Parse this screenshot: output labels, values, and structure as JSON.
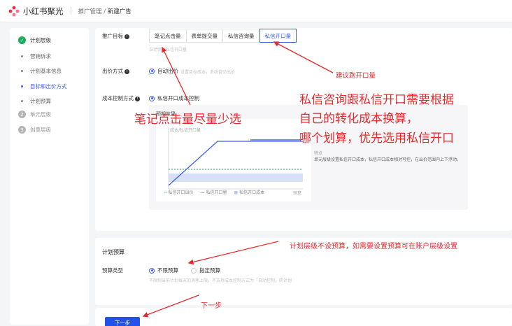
{
  "header": {
    "app_name": "小红书聚光",
    "breadcrumb_parent": "推广管理",
    "breadcrumb_sep": " / ",
    "breadcrumb_current": "新建广告"
  },
  "sidebar": {
    "steps": [
      {
        "num": "✓",
        "label": "计划层级",
        "state": "done"
      },
      {
        "num": "2",
        "label": "单元层级",
        "state": "pending"
      },
      {
        "num": "3",
        "label": "创意层级",
        "state": "pending"
      }
    ],
    "substeps": [
      {
        "label": "营销诉求"
      },
      {
        "label": "计划基本信息"
      },
      {
        "label": "目标和出价方式",
        "active": true
      },
      {
        "label": "计划预算"
      }
    ]
  },
  "form": {
    "goal_label": "推广目标",
    "goal_tabs": [
      "笔记点击量",
      "表单提交量",
      "私信咨询量",
      "私信开口量"
    ],
    "goal_selected": "私信开口量",
    "goal_hint": "自动优化私信开口量",
    "bid_label": "出价方式",
    "bid_option": "自动出价",
    "bid_hint": "设置目标成本，系统自动出价",
    "cost_label": "成本控制方式",
    "cost_option": "私信开口成本控制",
    "chart_title": "预期效果",
    "chart_ylabel": "成本/私信开口量",
    "chart_xlabel": "预算",
    "legend": [
      "私信开口出价",
      "私信开口量",
      "私信开口成本"
    ],
    "side_text_title": "特点",
    "side_text_body": "单元层级设置私信开口成本，私信开口成本相对可控，在出价范围内上下浮动。"
  },
  "budget": {
    "section_title": "计划预算",
    "type_label": "预算类型",
    "opt_unlimited": "不限预算",
    "opt_specified": "指定预算",
    "hint": "不限制当前计划每天的消耗上限，不支持成本控制方式为「自动控制」的计划"
  },
  "footer": {
    "next_label": "下一步"
  },
  "annotations": {
    "a1": "建议跑开口量",
    "a2_line1": "私信咨询跟私信开口需要根据",
    "a2_line2": "自己的转化成本换算，",
    "a2_line3": "哪个划算，优先选用私信开口",
    "a3": "笔记点击量尽量少选",
    "a4": "计划层级不设预算，如需要设置预算可在账户层级设置",
    "a5": "下一步"
  },
  "colors": {
    "accent": "#3b5ee6",
    "done": "#1aab5b",
    "annotation": "#e8282c",
    "logo": "#ff2442"
  }
}
